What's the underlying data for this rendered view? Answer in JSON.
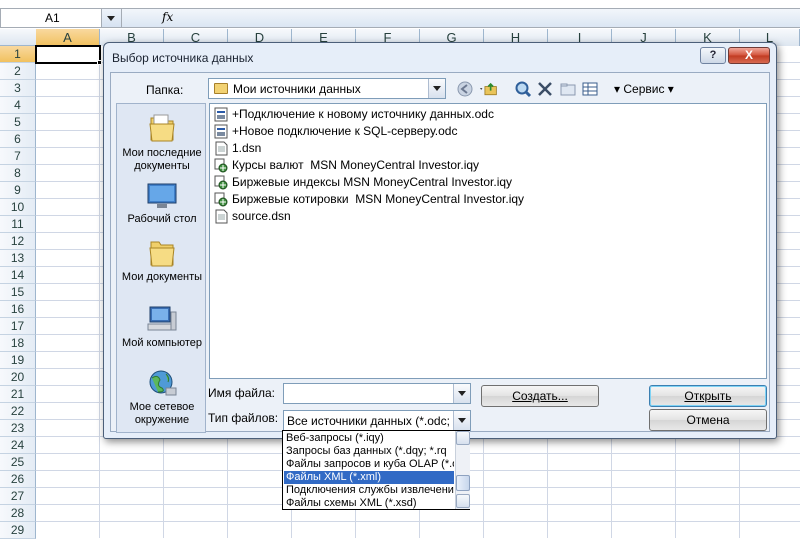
{
  "sheet": {
    "name_box": "A1",
    "fx_label": "fx",
    "columns": [
      "A",
      "B",
      "C",
      "D",
      "E",
      "F",
      "G",
      "H",
      "I",
      "J",
      "K",
      "L"
    ],
    "rows": [
      "1",
      "2",
      "3",
      "4",
      "5",
      "6",
      "7",
      "8",
      "9",
      "10",
      "11",
      "12",
      "13",
      "14",
      "15",
      "16",
      "17",
      "18",
      "19",
      "20",
      "21",
      "22",
      "23",
      "24",
      "25",
      "26",
      "27",
      "28",
      "29"
    ]
  },
  "dialog": {
    "title": "Выбор источника данных",
    "help": "?",
    "close": "X",
    "folder_label": "Папка:",
    "folder_value": "Мои источники данных",
    "service_label": "Сервис",
    "places": [
      {
        "label": "Мои последние документы",
        "icon": "recent-folder-icon"
      },
      {
        "label": "Рабочий стол",
        "icon": "desktop-icon"
      },
      {
        "label": "Мои документы",
        "icon": "documents-folder-icon"
      },
      {
        "label": "Мой компьютер",
        "icon": "computer-icon"
      },
      {
        "label": "Мое сетевое окружение",
        "icon": "network-icon"
      }
    ],
    "files": [
      {
        "name": "+Подключение к новому источнику данных.odc",
        "icon": "odc-icon"
      },
      {
        "name": "+Новое подключение к SQL-серверу.odc",
        "icon": "odc-icon"
      },
      {
        "name": "1.dsn",
        "icon": "dsn-icon"
      },
      {
        "name": "Курсы валют  MSN MoneyCentral Investor.iqy",
        "icon": "iqy-icon"
      },
      {
        "name": "Биржевые индексы MSN MoneyCentral Investor.iqy",
        "icon": "iqy-icon"
      },
      {
        "name": "Биржевые котировки  MSN MoneyCentral Investor.iqy",
        "icon": "iqy-icon"
      },
      {
        "name": "source.dsn",
        "icon": "dsn-icon"
      }
    ],
    "filename_label": "Имя файла:",
    "filename_value": "",
    "filetype_label": "Тип файлов:",
    "filetype_value": "Все источники данных (*.odc; *.",
    "create_label": "Создать...",
    "open_label": "Открыть",
    "cancel_label": "Отмена",
    "filetype_options": [
      {
        "label": "Веб-запросы (*.iqy)",
        "selected": false
      },
      {
        "label": "Запросы баз данных (*.dqy; *.rq",
        "selected": false
      },
      {
        "label": "Файлы запросов и куба OLAP (*.o",
        "selected": false
      },
      {
        "label": "Файлы XML (*.xml)",
        "selected": true
      },
      {
        "label": "Подключения службы извлечени",
        "selected": false
      },
      {
        "label": "Файлы схемы XML (*.xsd)",
        "selected": false
      }
    ]
  },
  "colors": {
    "dialog_bg": "#e6eef9",
    "highlight": "#316ac5",
    "grid_line": "#d0d7e5"
  }
}
